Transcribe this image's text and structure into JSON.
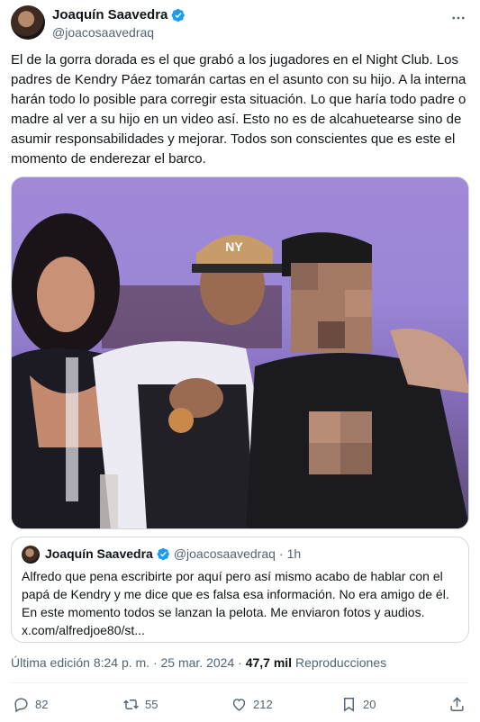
{
  "author": {
    "display_name": "Joaquín Saavedra",
    "handle": "@joacosaavedraq",
    "verified": true
  },
  "header": {
    "more_icon": "more-icon"
  },
  "tweet": {
    "text": "El de la gorra dorada es el que grabó a los jugadores en el Night Club. Los padres de Kendry Páez tomarán cartas en el asunto con su hijo. A la interna harán todo lo posible para corregir esta situación. Lo que haría todo padre o madre al ver a su hijo en un video así. Esto no es de alcahuetearse sino de asumir responsabilidades y mejorar. Todos son conscientes que es este el momento de enderezar el barco."
  },
  "media": {
    "cap_logo": "NY"
  },
  "quote": {
    "display_name": "Joaquín Saavedra",
    "handle": "@joacosaavedraq",
    "separator": "·",
    "age": "1h",
    "text": "Alfredo que pena escribirte por aquí pero así mismo acabo de hablar con el papá de Kendry y me dice que es falsa esa información. No era amigo de él. En este momento todos se lanzan la pelota. Me enviaron fotos y audios. x.com/alfredjoe80/st..."
  },
  "meta": {
    "edited_label": "Última edición 8:24 p. m. · 25 mar. 2024 ·",
    "views_count": "47,7 mil",
    "views_label": "Reproducciones"
  },
  "actions": {
    "replies": "82",
    "reposts": "55",
    "likes": "212",
    "bookmarks": "20"
  },
  "colors": {
    "text_primary": "#0f1419",
    "text_secondary": "#536471",
    "verified_blue": "#1d9bf0",
    "border": "#cfd9de"
  }
}
